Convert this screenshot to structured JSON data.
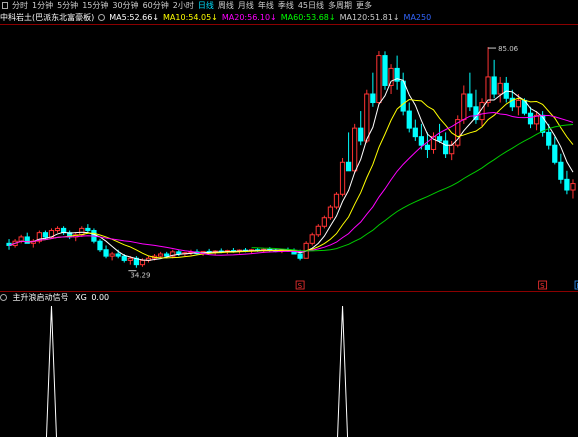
{
  "period_tabs": [
    "分时",
    "1分钟",
    "5分钟",
    "15分钟",
    "30分钟",
    "60分钟",
    "2小时",
    "日线",
    "周线",
    "月线",
    "年线",
    "季线",
    "45日线",
    "多周期",
    "更多"
  ],
  "active_tab": "日线",
  "title": "中科岩土(巴派东北富豪板)",
  "ma": [
    {
      "label": "MA5",
      "value": "52.66",
      "color": "#ffffff"
    },
    {
      "label": "MA10",
      "value": "54.05",
      "color": "#ffff00"
    },
    {
      "label": "MA20",
      "value": "56.10",
      "color": "#ff00ff"
    },
    {
      "label": "MA60",
      "value": "53.68",
      "color": "#00ff00"
    },
    {
      "label": "MA120",
      "value": "51.81",
      "color": "#cccccc"
    },
    {
      "label": "MA250",
      "value": "",
      "color": "#3366ff"
    }
  ],
  "price_high_label": "85.06",
  "price_low_label": "34.29",
  "markers": [
    {
      "text": "S",
      "color": "#ff3333"
    },
    {
      "text": "S",
      "color": "#ff3333"
    },
    {
      "text": "B",
      "color": "#3399ff"
    }
  ],
  "indicator": {
    "name": "主升浪启动信号",
    "value": "0.00",
    "prefix": "XG"
  },
  "colors": {
    "up": "#ff3333",
    "down": "#00ffff",
    "ma5": "#ffffff",
    "ma10": "#ffff00",
    "ma20": "#ff00ff",
    "ma60": "#00cc00",
    "signal": "#ffffff"
  },
  "chart_data": {
    "type": "candlestick",
    "ylim": [
      30,
      90
    ],
    "candles": [
      [
        40,
        41,
        38.5,
        39.5
      ],
      [
        39.5,
        41,
        39,
        40.5
      ],
      [
        40.5,
        42,
        40,
        41.5
      ],
      [
        41.5,
        42.5,
        40,
        40
      ],
      [
        40,
        41,
        39,
        40.5
      ],
      [
        40.5,
        43,
        40,
        42.5
      ],
      [
        42.5,
        43,
        41,
        41.5
      ],
      [
        41.5,
        43.5,
        41,
        43
      ],
      [
        43,
        44,
        42.5,
        43.5
      ],
      [
        43.5,
        44,
        42,
        42.5
      ],
      [
        42.5,
        43,
        41,
        41.5
      ],
      [
        41.5,
        42.5,
        40.5,
        42
      ],
      [
        42,
        44,
        41.5,
        43.5
      ],
      [
        43.5,
        44.5,
        42.5,
        43
      ],
      [
        43,
        43.5,
        40,
        40.5
      ],
      [
        40.5,
        41,
        38,
        38.5
      ],
      [
        38.5,
        39.5,
        36.5,
        37
      ],
      [
        37,
        38,
        36,
        37.5
      ],
      [
        37.5,
        38.5,
        36.5,
        37
      ],
      [
        37,
        37.5,
        35.5,
        36
      ],
      [
        36,
        37,
        35,
        36.5
      ],
      [
        36.5,
        37,
        34.29,
        35
      ],
      [
        35,
        36.5,
        34.5,
        36
      ],
      [
        36,
        37,
        35.5,
        36.5
      ],
      [
        36.5,
        37.5,
        36,
        37
      ],
      [
        37,
        38,
        36.5,
        37.5
      ],
      [
        37.5,
        38,
        36.5,
        37
      ],
      [
        37,
        38.5,
        36.5,
        38
      ],
      [
        38,
        38.5,
        37,
        37.5
      ],
      [
        37.5,
        38,
        37,
        37.8
      ],
      [
        37.8,
        38.5,
        37.2,
        38
      ],
      [
        38,
        38.6,
        37.4,
        37.6
      ],
      [
        37.6,
        38.2,
        37.1,
        38.1
      ],
      [
        38.1,
        38.7,
        37.6,
        37.9
      ],
      [
        37.9,
        38.4,
        37.3,
        38.2
      ],
      [
        38.2,
        38.8,
        37.7,
        38
      ],
      [
        38,
        38.5,
        37.5,
        38.3
      ],
      [
        38.3,
        38.9,
        37.8,
        38.1
      ],
      [
        38.1,
        38.6,
        37.6,
        38.4
      ],
      [
        38.4,
        38.9,
        37.9,
        38.2
      ],
      [
        38.2,
        38.7,
        37.6,
        38.5
      ],
      [
        38.5,
        39,
        38,
        38.3
      ],
      [
        38.3,
        38.8,
        37.8,
        38.6
      ],
      [
        38.6,
        39.1,
        38.1,
        38.4
      ],
      [
        38.4,
        38.9,
        37.9,
        38.2
      ],
      [
        38.2,
        38.7,
        37.7,
        38.5
      ],
      [
        38.5,
        39,
        38,
        38.3
      ],
      [
        38.3,
        38.8,
        37.8,
        37.5
      ],
      [
        37.5,
        38.5,
        36,
        36.5
      ],
      [
        36.5,
        40.5,
        36.5,
        40
      ],
      [
        40,
        42.5,
        39.5,
        42
      ],
      [
        42,
        44.5,
        41.5,
        44
      ],
      [
        44,
        46.5,
        43.5,
        46
      ],
      [
        46,
        49,
        45.5,
        48.5
      ],
      [
        48.5,
        52,
        48,
        51.5
      ],
      [
        51.5,
        60,
        51,
        59
      ],
      [
        59,
        66,
        58,
        57
      ],
      [
        57,
        68,
        56.5,
        67
      ],
      [
        67,
        71,
        63,
        64
      ],
      [
        64,
        76,
        63.5,
        75
      ],
      [
        75,
        80,
        72,
        73
      ],
      [
        73,
        85.06,
        72.5,
        84
      ],
      [
        84,
        85,
        76,
        77
      ],
      [
        77,
        82,
        75,
        81
      ],
      [
        81,
        84,
        76,
        78
      ],
      [
        78,
        80,
        70,
        71
      ],
      [
        71,
        73,
        66,
        67
      ],
      [
        67,
        69,
        64,
        65
      ],
      [
        65,
        68,
        62,
        63
      ],
      [
        63,
        66,
        60,
        62
      ],
      [
        62,
        66,
        61,
        65
      ],
      [
        65,
        68,
        63.5,
        64
      ],
      [
        64,
        66,
        60,
        61
      ],
      [
        61,
        64,
        59.5,
        63
      ],
      [
        63,
        70,
        62.5,
        69
      ],
      [
        69,
        77,
        68,
        75
      ],
      [
        75,
        80,
        71,
        72
      ],
      [
        72,
        76,
        68,
        69
      ],
      [
        69,
        74,
        67.5,
        73
      ],
      [
        73,
        86,
        72,
        79
      ],
      [
        79,
        83,
        74,
        75
      ],
      [
        75,
        79,
        73,
        77.5
      ],
      [
        77.5,
        79,
        73,
        74
      ],
      [
        74,
        76,
        71,
        72
      ],
      [
        72,
        75,
        70,
        73.5
      ],
      [
        73.5,
        74,
        70,
        70.5
      ],
      [
        70.5,
        72,
        67,
        68
      ],
      [
        68,
        71,
        66.5,
        70
      ],
      [
        70,
        71,
        65,
        66
      ],
      [
        66,
        68,
        62,
        63
      ],
      [
        63,
        65,
        58.5,
        59
      ],
      [
        59,
        61,
        54,
        55
      ],
      [
        55,
        57,
        51.5,
        52.5
      ],
      [
        52.5,
        55,
        50.5,
        54
      ]
    ]
  }
}
